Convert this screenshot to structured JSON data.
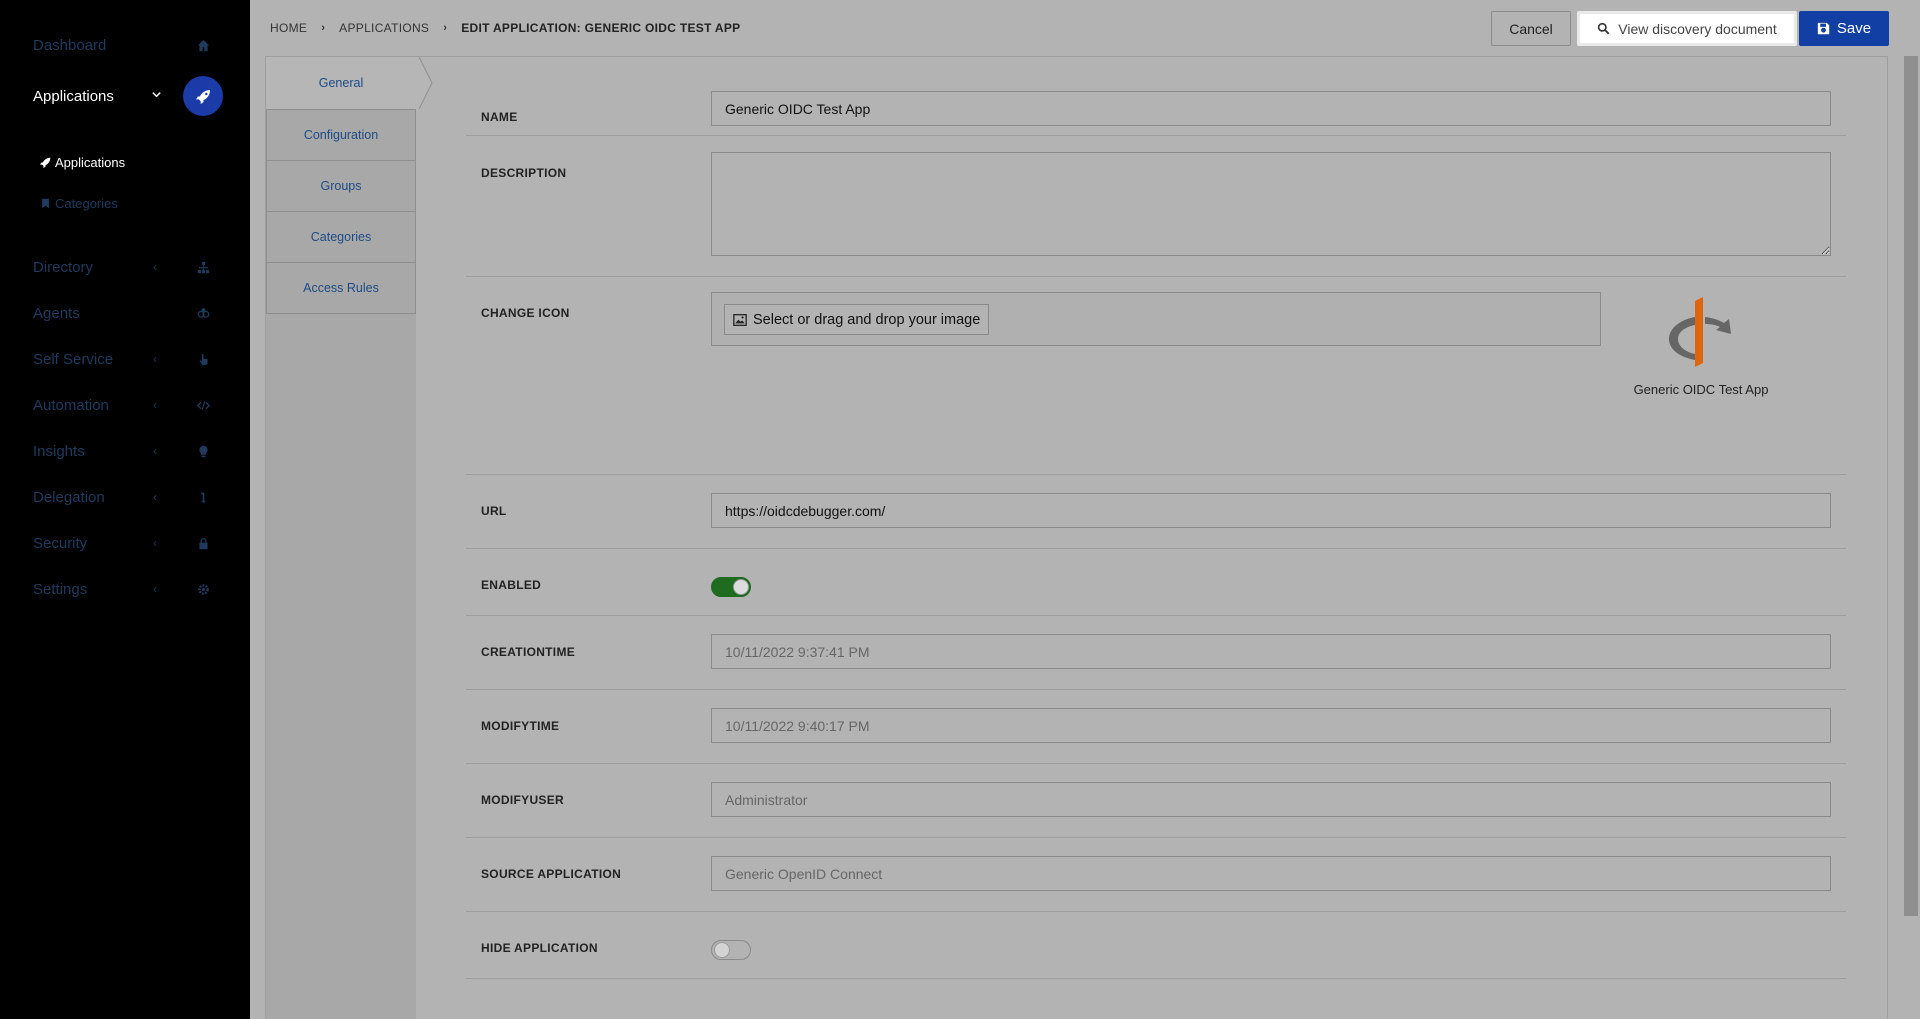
{
  "sidebar": {
    "dashboard": "Dashboard",
    "applications": "Applications",
    "sub_applications": "Applications",
    "sub_categories": "Categories",
    "directory": "Directory",
    "agents": "Agents",
    "self_service": "Self Service",
    "automation": "Automation",
    "insights": "Insights",
    "delegation": "Delegation",
    "security": "Security",
    "settings": "Settings"
  },
  "breadcrumb": {
    "home": "HOME",
    "applications": "APPLICATIONS",
    "current": "EDIT APPLICATION: GENERIC OIDC TEST APP"
  },
  "toolbar": {
    "cancel": "Cancel",
    "discovery": "View discovery document",
    "save": "Save"
  },
  "tabs": [
    "General",
    "Configuration",
    "Groups",
    "Categories",
    "Access Rules"
  ],
  "form": {
    "name_label": "NAME",
    "name_value": "Generic OIDC Test App",
    "description_label": "DESCRIPTION",
    "description_value": "",
    "icon_label": "CHANGE ICON",
    "icon_button": "Select or drag and drop your image",
    "icon_preview_name": "Generic OIDC Test App",
    "url_label": "URL",
    "url_value": "https://oidcdebugger.com/",
    "enabled_label": "ENABLED",
    "creationtime_label": "CREATIONTIME",
    "creationtime_value": "10/11/2022 9:37:41 PM",
    "modifytime_label": "MODIFYTIME",
    "modifytime_value": "10/11/2022 9:40:17 PM",
    "modifyuser_label": "MODIFYUSER",
    "modifyuser_value": "Administrator",
    "source_label": "SOURCE APPLICATION",
    "source_value": "Generic OpenID Connect",
    "hide_label": "HIDE APPLICATION"
  },
  "colors": {
    "accent": "#123fa3",
    "toggle_on": "#1f6b1f",
    "sidebar_bg": "#000000"
  }
}
